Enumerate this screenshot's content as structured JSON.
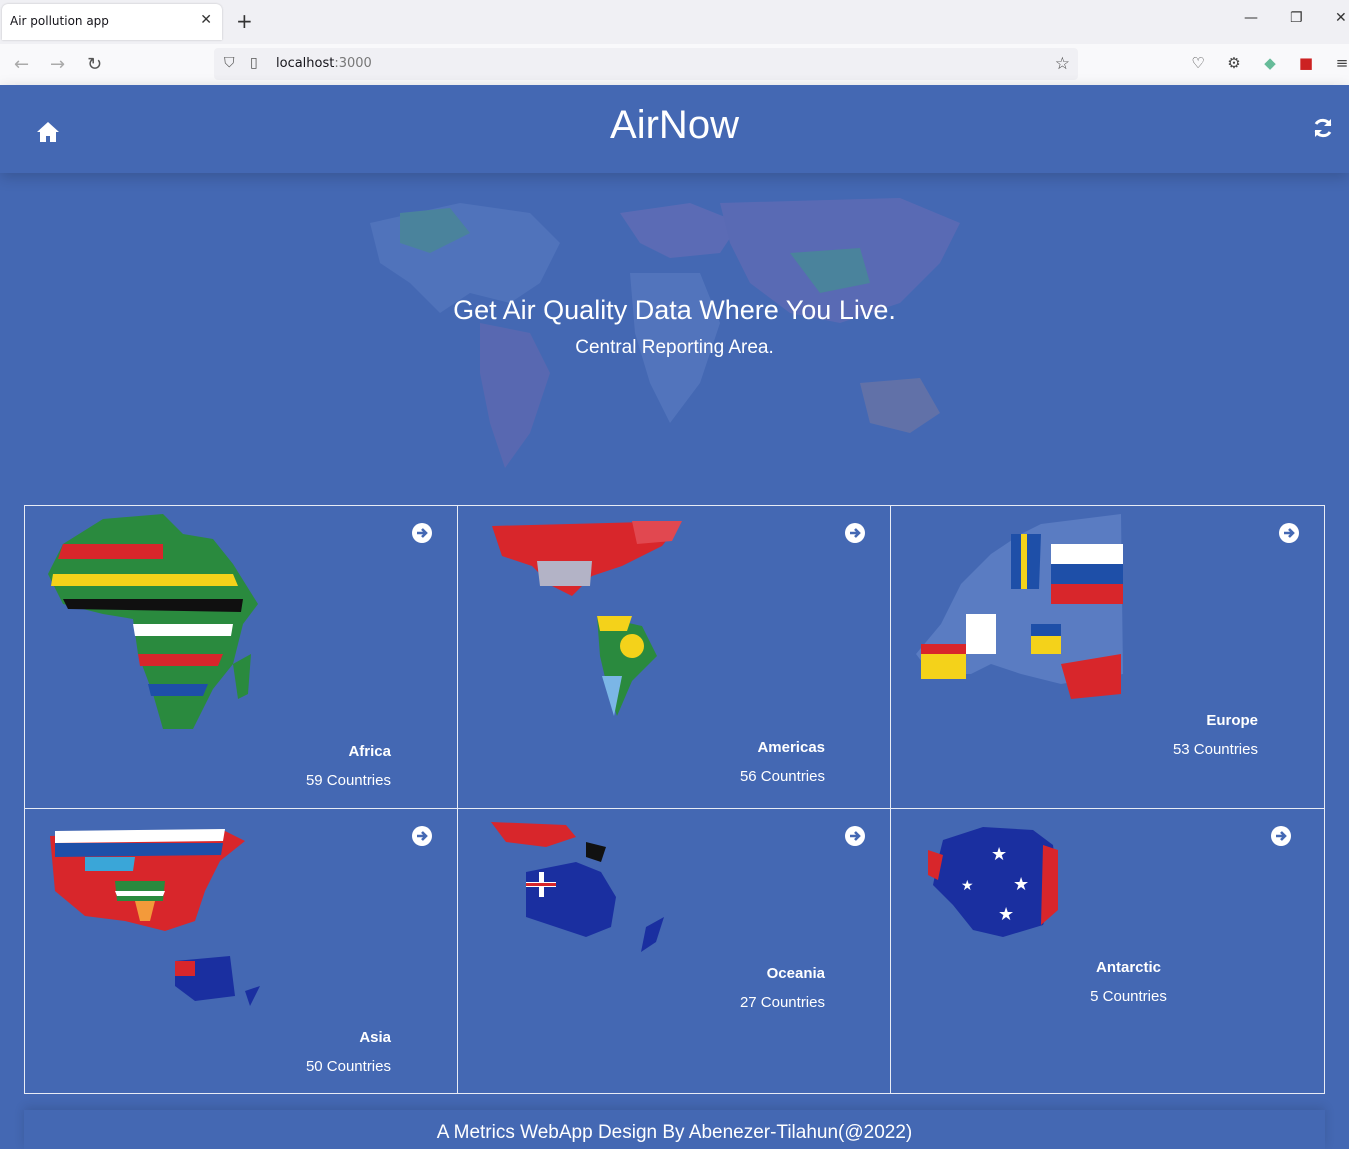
{
  "browser": {
    "tab_title": "Air pollution app",
    "url_host": "localhost",
    "url_port": ":3000"
  },
  "header": {
    "title": "AirNow"
  },
  "hero": {
    "title": "Get Air Quality Data Where You Live.",
    "subtitle": "Central Reporting Area."
  },
  "regions": [
    {
      "name": "Africa",
      "count": "59 Countries"
    },
    {
      "name": "Americas",
      "count": "56 Countries"
    },
    {
      "name": "Europe",
      "count": "53 Countries"
    },
    {
      "name": "Asia",
      "count": "50 Countries"
    },
    {
      "name": "Oceania",
      "count": "27 Countries"
    },
    {
      "name": "Antarctic",
      "count": "5 Countries"
    }
  ],
  "footer": {
    "text": "A Metrics WebApp Design By Abenezer-Tilahun(@2022)"
  },
  "colors": {
    "background": "#4468b3",
    "text": "#ffffff"
  }
}
